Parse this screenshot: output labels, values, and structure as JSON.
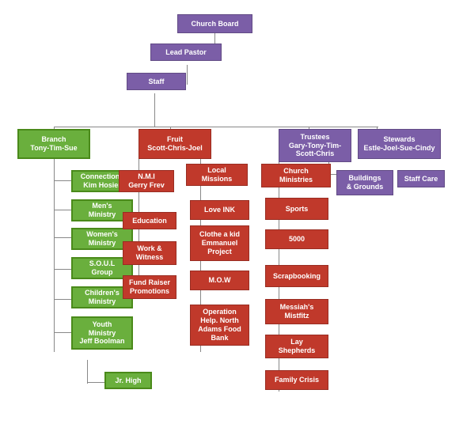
{
  "nodes": {
    "church_board": {
      "label": "Church Board"
    },
    "lead_pastor": {
      "label": "Lead Pastor"
    },
    "staff": {
      "label": "Staff"
    },
    "branch": {
      "label": "Branch\nTony-Tim-Sue"
    },
    "fruit": {
      "label": "Fruit\nScott-Chris-Joel"
    },
    "trustees": {
      "label": "Trustees\nGary-Tony-Tim-\nScott-Chris"
    },
    "stewards": {
      "label": "Stewards\nEstle-Joel-Sue-Cindy"
    },
    "connections": {
      "label": "Connections\nKim Hosier"
    },
    "mens_ministry": {
      "label": "Men's\nMinistry"
    },
    "womens_ministry": {
      "label": "Women's\nMinistry"
    },
    "soul_group": {
      "label": "S.O.U.L\nGroup"
    },
    "childrens_ministry": {
      "label": "Children's\nMinistry"
    },
    "youth_ministry": {
      "label": "Youth\nMinistry\nJeff Boolman"
    },
    "jr_high": {
      "label": "Jr. High"
    },
    "nmi": {
      "label": "N.M.I\nGerry Frev"
    },
    "education": {
      "label": "Education"
    },
    "work_witness": {
      "label": "Work &\nWitness"
    },
    "fund_raiser": {
      "label": "Fund Raiser\nPromotions"
    },
    "local_missions": {
      "label": "Local\nMissions"
    },
    "love_ink": {
      "label": "Love INK"
    },
    "clothe_emmanuel": {
      "label": "Clothe a kid\nEmmanuel\nProject"
    },
    "mow": {
      "label": "M.O.W"
    },
    "operation_help": {
      "label": "Operation\nHelp. North\nAdams Food\nBank"
    },
    "church_ministries": {
      "label": "Church\nMinistries"
    },
    "sports": {
      "label": "Sports"
    },
    "five000": {
      "label": "5000"
    },
    "scrapbooking": {
      "label": "Scrapbooking"
    },
    "messiahs": {
      "label": "Messiah's\nMistfitz"
    },
    "lay_shepherds": {
      "label": "Lay\nShepherds"
    },
    "family_crisis": {
      "label": "Family Crisis"
    },
    "buildings": {
      "label": "Buildings\n& Grounds"
    },
    "staff_care": {
      "label": "Staff Care"
    }
  }
}
